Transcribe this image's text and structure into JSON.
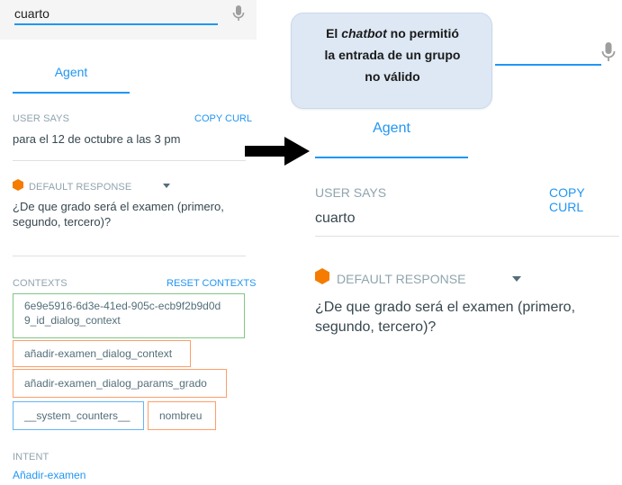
{
  "left": {
    "query_value": "cuarto",
    "tab_label": "Agent",
    "user_says": {
      "label": "USER SAYS",
      "link": "COPY CURL",
      "text": "para el 12 de octubre a las 3 pm"
    },
    "default_response": {
      "label": "DEFAULT RESPONSE",
      "text_line1": "¿De que grado será el examen (primero,",
      "text_line2": "segundo, tercero)?"
    },
    "contexts": {
      "label": "CONTEXTS",
      "link": "RESET CONTEXTS",
      "chip1_line1": "6e9e5916-6d3e-41ed-905c-ecb9f2b9d0d",
      "chip1_line2": "9_id_dialog_context",
      "chip2": "añadir-examen_dialog_context",
      "chip3": "añadir-examen_dialog_params_grado",
      "chip4": "__system_counters__",
      "chip5": "nombreu"
    },
    "intent": {
      "label": "INTENT",
      "value": "Añadir-examen"
    }
  },
  "right": {
    "tab_label": "Agent",
    "user_says": {
      "label": "USER SAYS",
      "link": "COPY CURL",
      "text": "cuarto"
    },
    "default_response": {
      "label": "DEFAULT RESPONSE",
      "text_line1": "¿De que grado será el examen (primero,",
      "text_line2": "segundo, tercero)?"
    }
  },
  "callout": {
    "line1_a": "El ",
    "line1_b": "chatbot",
    "line1_c": " no permitió",
    "line2": "la entrada de un grupo",
    "line3": "no válido"
  },
  "colors": {
    "accent": "#2196f3",
    "chip_green": "#81c784",
    "chip_orange": "#ff9e6a",
    "chip_blue": "#64b5f6",
    "response_icon": "#f57c00",
    "callout_bg": "#dde8f4"
  },
  "icons": [
    "microphone-icon",
    "default-response-hex-icon",
    "dropdown-caret-icon",
    "right-arrow-icon"
  ]
}
